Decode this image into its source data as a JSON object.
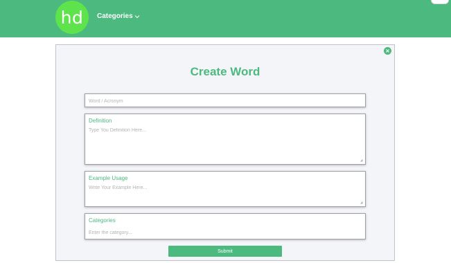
{
  "header": {
    "logo_text": "hd",
    "nav_categories_label": "Categories"
  },
  "modal": {
    "title": "Create Word",
    "word_field": {
      "placeholder": "Word / Acronym",
      "value": ""
    },
    "definition_field": {
      "label": "Definition",
      "placeholder": "Type You Definition Here...",
      "value": ""
    },
    "example_field": {
      "label": "Example Usage",
      "placeholder": "Write Your Example Here...",
      "value": ""
    },
    "categories_field": {
      "label": "Categories",
      "placeholder": "Enter the category...",
      "value": ""
    },
    "submit_label": "Submit"
  },
  "icons": {
    "nav_dropdown": "chevron-down-icon",
    "close": "close-icon",
    "resize": "resize-grip-icon"
  },
  "colors": {
    "brand_green": "#4cb97e",
    "logo_green": "#5ee34c",
    "modal_background": "#f4f5f8"
  }
}
